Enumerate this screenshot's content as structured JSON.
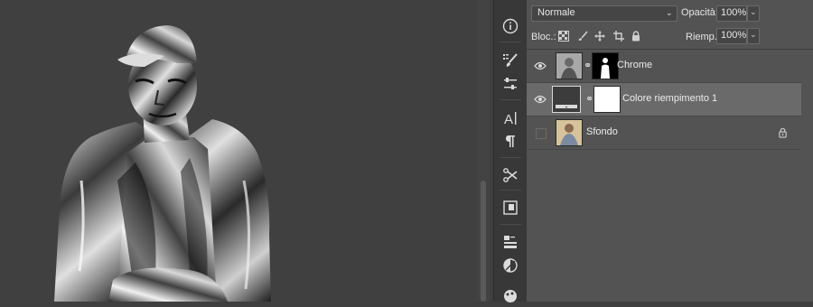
{
  "layers_panel": {
    "blend_mode": "Normale",
    "opacity_label": "Opacità:",
    "opacity_value": "100%",
    "lock_label": "Bloc.:",
    "fill_label": "Riemp.:",
    "fill_value": "100%",
    "layers": [
      {
        "name": "Chrome",
        "visible": true,
        "selected": false
      },
      {
        "name": "Colore riempimento 1",
        "visible": true,
        "selected": true
      },
      {
        "name": "Sfondo",
        "visible": false,
        "selected": false,
        "locked": true
      }
    ]
  },
  "tools": [
    "info-icon",
    "brush-preset-icon",
    "adjust-icon",
    "character-icon",
    "paragraph-icon",
    "tool-preset-icon",
    "navigator-icon",
    "layer-comps-icon",
    "adjustments-icon",
    "styles-icon"
  ],
  "canvas": {
    "subject": "chrome-effect photo of man in cap and jacket"
  },
  "colors": {
    "panel_bg": "#535353",
    "selected_row": "#6a6a6a",
    "canvas_bg": "#404040"
  }
}
